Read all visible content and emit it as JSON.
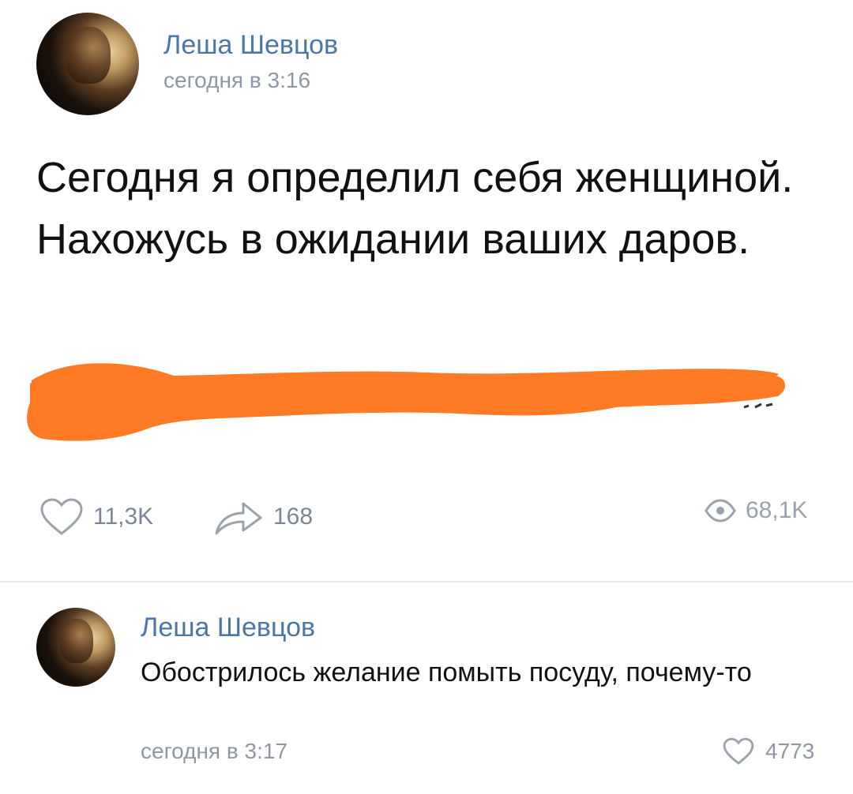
{
  "post": {
    "author": "Леша Шевцов",
    "time": "сегодня в 3:16",
    "text": "Сегодня я определил себя женщиной. Нахожусь в ожидании ваших даров.",
    "likes": "11,3K",
    "reposts": "168",
    "views": "68,1K"
  },
  "comment": {
    "author": "Леша Шевцов",
    "text": "Обострилось желание помыть посуду, почему-то",
    "time": "сегодня в 3:17",
    "likes": "4773"
  },
  "colors": {
    "link": "#4a76a8",
    "censor": "#ff7a24",
    "muted": "#8e97a3"
  },
  "icons": [
    "heart-icon",
    "share-arrow-icon",
    "eye-icon"
  ]
}
